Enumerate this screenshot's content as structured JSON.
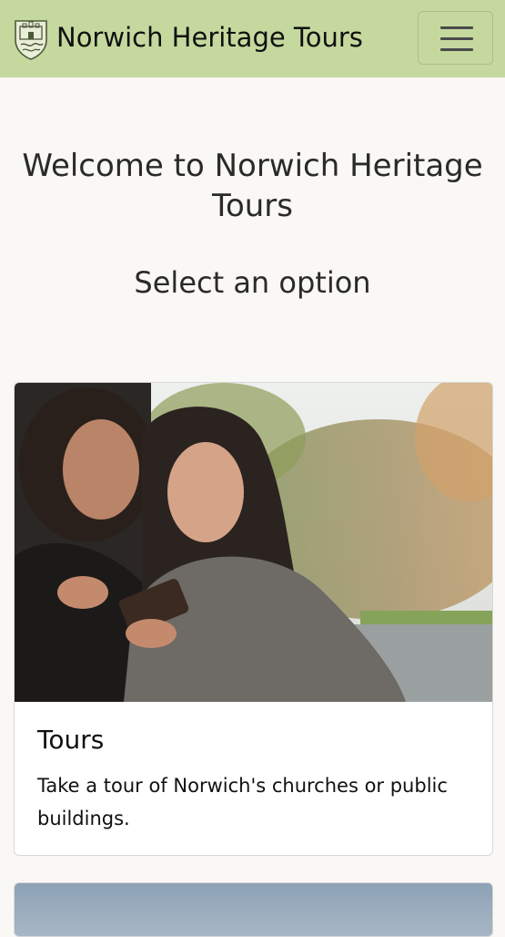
{
  "navbar": {
    "brand": "Norwich Heritage Tours",
    "brand_logo_icon": "coat-of-arms-icon",
    "toggle_icon": "hamburger-icon",
    "background": "#c5d99e"
  },
  "main": {
    "welcome": "Welcome to Norwich Heritage Tours",
    "subtitle": "Select an option"
  },
  "cards": [
    {
      "title": "Tours",
      "text": "Take a tour of Norwich's churches or public buildings."
    }
  ]
}
